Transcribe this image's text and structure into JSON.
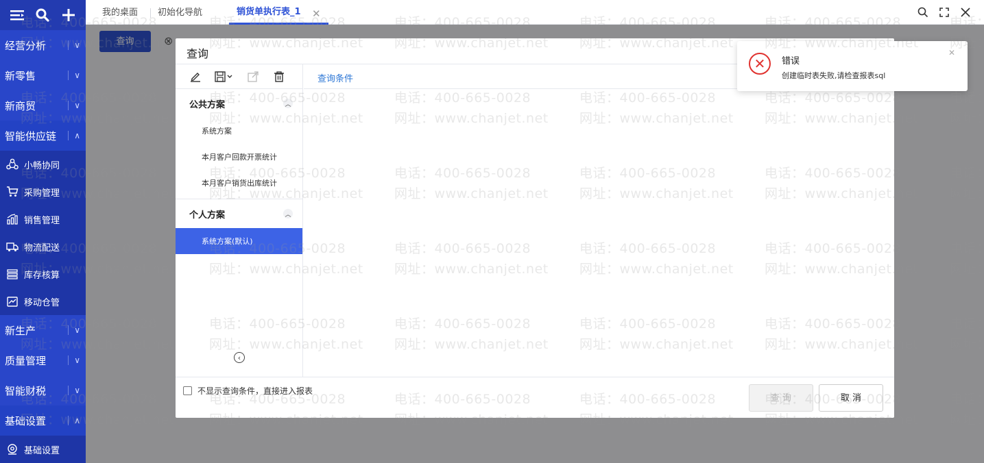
{
  "sidebar": {
    "groups": [
      {
        "label": "经营分析"
      },
      {
        "label": "新零售"
      },
      {
        "label": "新商贸"
      },
      {
        "label": "智能供应链"
      },
      {
        "label": "新生产"
      },
      {
        "label": "质量管理"
      },
      {
        "label": "智能财税"
      },
      {
        "label": "基础设置"
      }
    ],
    "supply_items": [
      {
        "label": "小畅协同",
        "icon": "collab-icon"
      },
      {
        "label": "采购管理",
        "icon": "cart-icon"
      },
      {
        "label": "销售管理",
        "icon": "sales-chart-icon"
      },
      {
        "label": "物流配送",
        "icon": "truck-icon"
      },
      {
        "label": "库存核算",
        "icon": "stack-icon"
      },
      {
        "label": "移动仓管",
        "icon": "warehouse-icon"
      }
    ],
    "basic_items": [
      {
        "label": "基础设置",
        "icon": "settings-icon"
      }
    ]
  },
  "tabs": [
    {
      "label": "我的桌面"
    },
    {
      "label": "初始化导航"
    },
    {
      "label": "销货单执行表_1"
    }
  ],
  "content": {
    "query_label": "查询"
  },
  "dialog": {
    "title": "查询",
    "public_section": "公共方案",
    "public_schemes": [
      "系统方案",
      "本月客户回款开票统计",
      "本月客户销货出库统计"
    ],
    "personal_section": "个人方案",
    "personal_schemes": [
      "系统方案(默认)"
    ],
    "right_tab": "查询条件",
    "skip_label": "不显示查询条件，直接进入报表",
    "query_button": "查 询",
    "cancel_button": "取 消"
  },
  "toast": {
    "title": "错误",
    "message": "创建临时表失败,请检查报表sql"
  },
  "watermark": {
    "phone": "电话：400-665-0028",
    "site": "网址：www.chanjet.net"
  },
  "colors": {
    "accent": "#2f53d6",
    "sidebar": "#2946c9",
    "error": "#e0322f",
    "selected": "#3d63e6"
  }
}
